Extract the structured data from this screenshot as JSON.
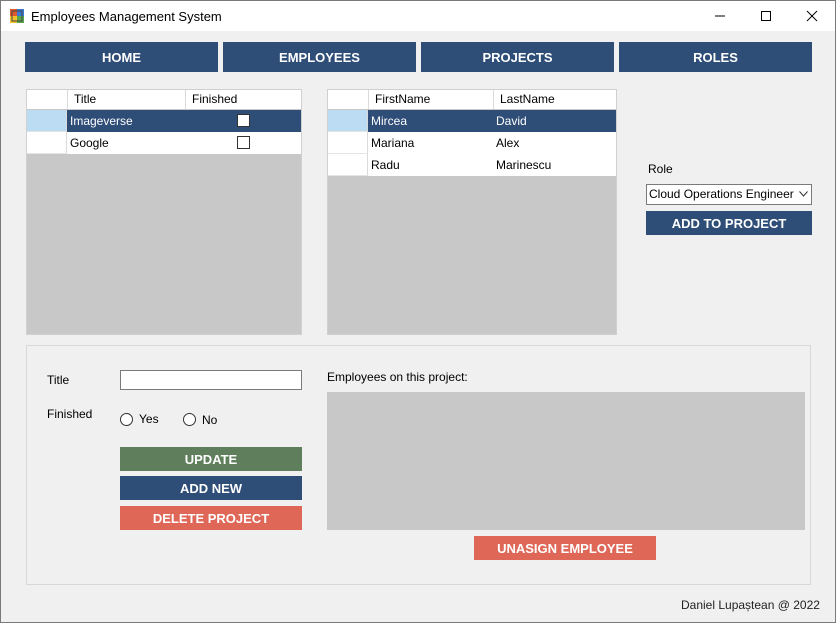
{
  "window": {
    "title": "Employees Management System",
    "min_icon": "minimize-icon",
    "max_icon": "maximize-icon",
    "close_icon": "close-icon"
  },
  "nav": {
    "home": "HOME",
    "employees": "EMPLOYEES",
    "projects": "PROJECTS",
    "roles": "ROLES"
  },
  "projects_grid": {
    "columns": [
      "Title",
      "Finished"
    ],
    "rows": [
      {
        "title": "Imageverse",
        "finished": false,
        "selected": true
      },
      {
        "title": "Google",
        "finished": false,
        "selected": false
      }
    ]
  },
  "employees_grid": {
    "columns": [
      "FirstName",
      "LastName"
    ],
    "rows": [
      {
        "first": "Mircea",
        "last": "David",
        "selected": true
      },
      {
        "first": "Mariana",
        "last": "Alex",
        "selected": false
      },
      {
        "first": "Radu",
        "last": "Marinescu",
        "selected": false
      }
    ]
  },
  "role": {
    "label": "Role",
    "selected": "Cloud Operations Engineer",
    "add_button": "ADD TO PROJECT"
  },
  "form": {
    "title_label": "Title",
    "title_value": "",
    "finished_label": "Finished",
    "yes_label": "Yes",
    "no_label": "No",
    "update_button": "UPDATE",
    "add_new_button": "ADD NEW",
    "delete_button": "DELETE PROJECT"
  },
  "assigned": {
    "label": "Employees on this project:",
    "unassign_button": "UNASIGN EMPLOYEE"
  },
  "footer": "Daniel Lupaștean @ 2022",
  "colors": {
    "primary": "#2e4d77",
    "success": "#5f7f5c",
    "danger": "#df6758",
    "selected_rowhead": "#bcdcf4"
  }
}
